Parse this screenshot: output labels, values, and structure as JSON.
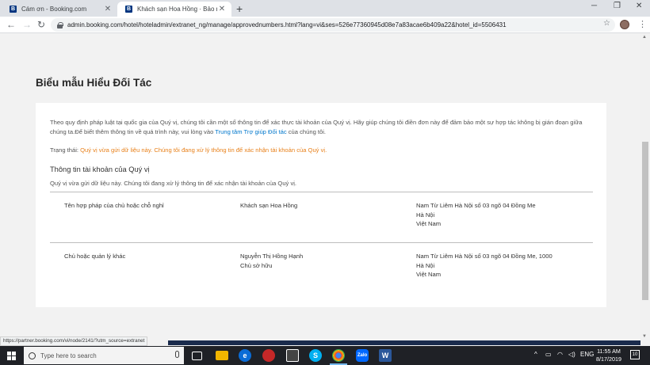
{
  "browser": {
    "tabs": [
      {
        "favicon": "B",
        "label": "Cám ơn - Booking.com",
        "active": false
      },
      {
        "favicon": "B",
        "label": "Khách sạn Hoa Hồng · Bảo mật",
        "active": true
      }
    ],
    "url": "admin.booking.com/hotel/hoteladmin/extranet_ng/manage/approvednumbers.html?lang=vi&ses=526e77360945d08e7a83acae6b409a22&hotel_id=5506431",
    "status_url": "https://partner.booking.com/vi/node/2141/?utm_source=extranet"
  },
  "page": {
    "title": "Biểu mẫu Hiểu Đối Tác",
    "intro_text": "Theo quy định pháp luật tại quốc gia của Quý vị, chúng tôi cần một số thông tin để xác thực tài khoản của Quý vị. Hãy giúp chúng tôi điền đơn này để đảm bảo một sự hợp tác không bị gián đoạn giữa chúng ta.Để biết thêm thông tin về quá trình này, vui lòng vào ",
    "intro_link": "Trung tâm Trợ giúp Đối tác",
    "intro_suffix": " của chúng tôi.",
    "status_label": "Trạng thái: ",
    "status_value": "Quý vị vừa gửi dữ liệu này. Chúng tôi đang xử lý thông tin để xác nhận tài khoản của Quý vị.",
    "section_title": "Thông tin tài khoản của Quý vị",
    "section_desc": "Quý vị vừa gửi dữ liệu này. Chúng tôi đang xử lý thông tin để xác nhận tài khoản của Quý vị.",
    "rows": [
      {
        "label": "Tên hợp pháp của chủ hoặc chỗ nghỉ",
        "value": [
          "Khách sạn Hoa Hồng"
        ],
        "address": [
          "Nam Từ Liêm Hà Nội số 03 ngõ 04 Đồng Me",
          "Hà Nội",
          "Việt Nam"
        ]
      },
      {
        "label": "Chủ hoặc quản lý khác",
        "value": [
          "Nguyễn Thị Hồng Hạnh",
          "Chủ sở hữu"
        ],
        "address": [
          "Nam Từ Liêm Hà Nội số 03 ngõ 04 Đồng Me, 1000",
          "Hà Nội",
          "Việt Nam"
        ]
      }
    ]
  },
  "taskbar": {
    "search_placeholder": "Type here to search",
    "language": "ENG",
    "time": "11:55 AM",
    "date": "8/17/2019",
    "notifications": "10",
    "icons": [
      {
        "name": "task-view",
        "color": "#1f2126"
      },
      {
        "name": "file-explorer",
        "color": "#f2b600"
      },
      {
        "name": "edge",
        "color": "#0a6cd6"
      },
      {
        "name": "app-red",
        "color": "#c62828"
      },
      {
        "name": "store",
        "color": "#444444"
      },
      {
        "name": "skype",
        "color": "#00aff0"
      },
      {
        "name": "chrome",
        "color": "#4caf50"
      },
      {
        "name": "zalo",
        "color": "#0068ff"
      },
      {
        "name": "word",
        "color": "#2b579a"
      }
    ]
  }
}
